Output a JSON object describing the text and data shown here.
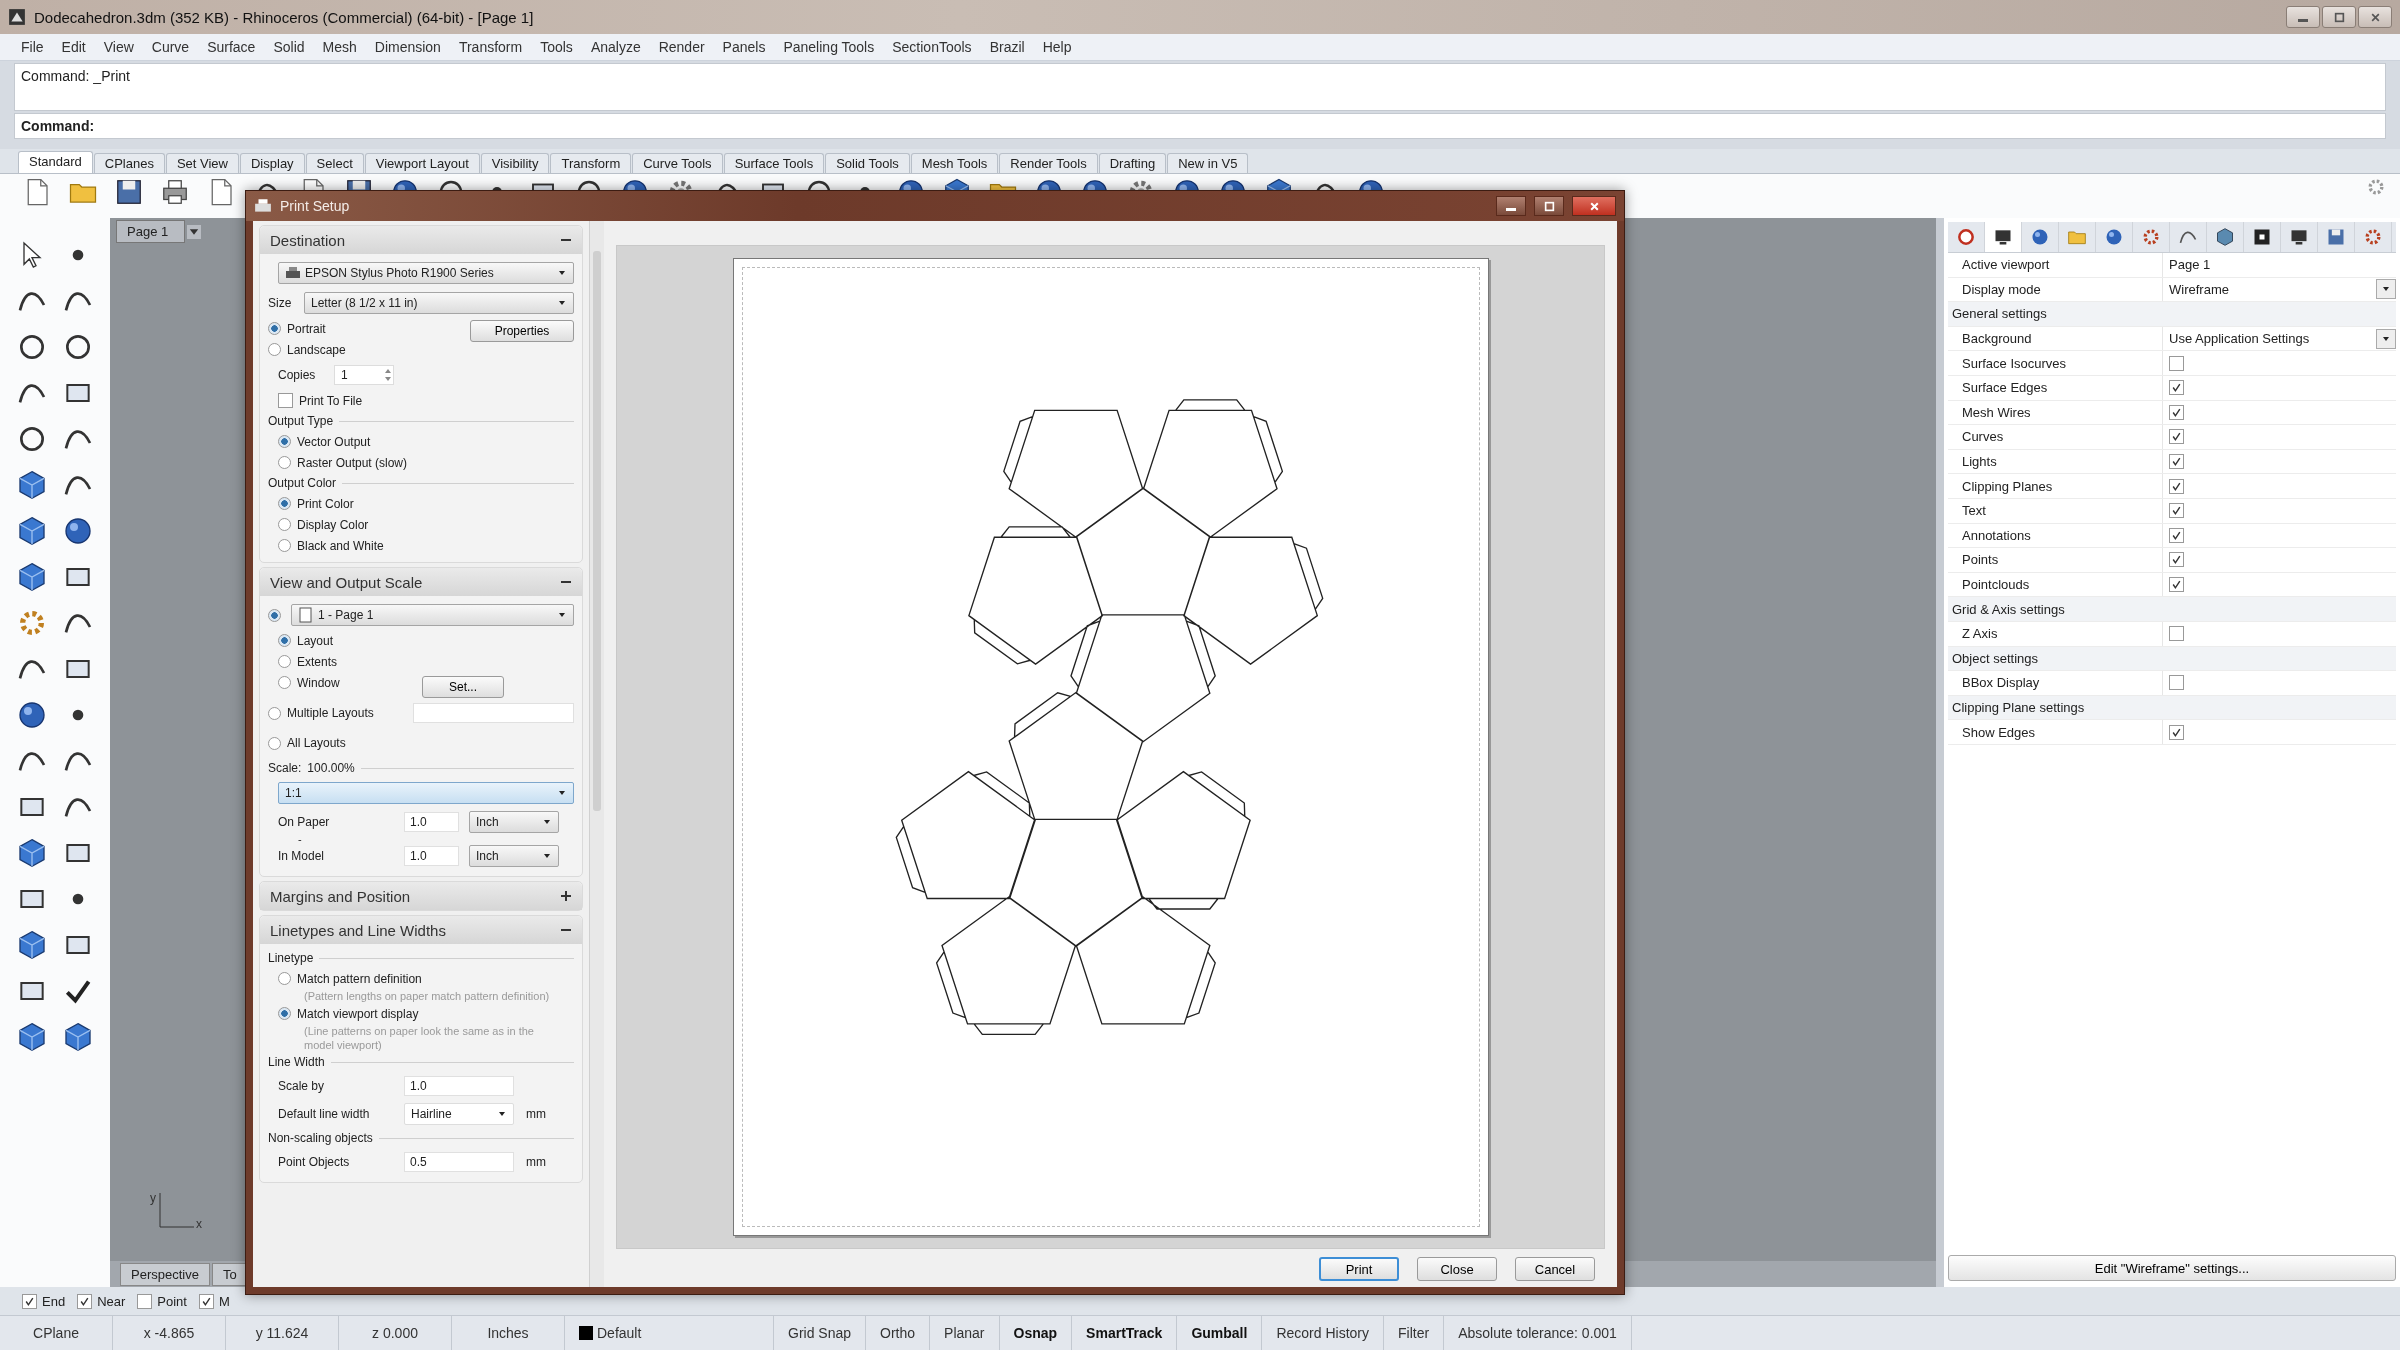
{
  "window": {
    "title": "Dodecahedron.3dm (352 KB) - Rhinoceros (Commercial) (64-bit) - [Page 1]"
  },
  "menu": [
    "File",
    "Edit",
    "View",
    "Curve",
    "Surface",
    "Solid",
    "Mesh",
    "Dimension",
    "Transform",
    "Tools",
    "Analyze",
    "Render",
    "Panels",
    "Paneling Tools",
    "SectionTools",
    "Brazil",
    "Help"
  ],
  "command": {
    "history": "Command: _Print",
    "prompt": "Command:"
  },
  "toolbar_tabs": [
    {
      "label": "Standard",
      "selected": true
    },
    {
      "label": "CPlanes",
      "selected": false
    },
    {
      "label": "Set View",
      "selected": false
    },
    {
      "label": "Display",
      "selected": false
    },
    {
      "label": "Select",
      "selected": false
    },
    {
      "label": "Viewport Layout",
      "selected": false
    },
    {
      "label": "Visibility",
      "selected": false
    },
    {
      "label": "Transform",
      "selected": false
    },
    {
      "label": "Curve Tools",
      "selected": false
    },
    {
      "label": "Surface Tools",
      "selected": false
    },
    {
      "label": "Solid Tools",
      "selected": false
    },
    {
      "label": "Mesh Tools",
      "selected": false
    },
    {
      "label": "Render Tools",
      "selected": false
    },
    {
      "label": "Drafting",
      "selected": false
    },
    {
      "label": "New in V5",
      "selected": false
    }
  ],
  "viewport": {
    "page_tab": "Page 1",
    "axis_x": "x",
    "axis_y": "y",
    "tabs": [
      {
        "label": "Perspective",
        "selected": false
      },
      {
        "label": "To",
        "selected": false
      }
    ]
  },
  "osnaps": [
    {
      "label": "End",
      "checked": true
    },
    {
      "label": "Near",
      "checked": true
    },
    {
      "label": "Point",
      "checked": false
    },
    {
      "label": "M",
      "checked": true
    }
  ],
  "print_setup": {
    "title": "Print Setup",
    "destination": {
      "title": "Destination",
      "expanded": true,
      "printer": "EPSON Stylus Photo R1900 Series",
      "size_label": "Size",
      "size": "Letter (8 1/2 x 11 in)",
      "orientations": [
        {
          "label": "Portrait",
          "selected": true
        },
        {
          "label": "Landscape",
          "selected": false
        }
      ],
      "properties_button": "Properties",
      "copies_label": "Copies",
      "copies": "1",
      "print_to_file": {
        "label": "Print To File",
        "checked": false
      },
      "output_type": {
        "title": "Output Type",
        "options": [
          {
            "label": "Vector Output",
            "selected": true
          },
          {
            "label": "Raster Output (slow)",
            "selected": false
          }
        ]
      },
      "output_color": {
        "title": "Output Color",
        "options": [
          {
            "label": "Print Color",
            "selected": true
          },
          {
            "label": "Display Color",
            "selected": false
          },
          {
            "label": "Black and White",
            "selected": false
          }
        ]
      }
    },
    "view_scale": {
      "title": "View and Output Scale",
      "expanded": true,
      "view_selected": true,
      "view": "1 - Page 1",
      "modes": [
        {
          "label": "Layout",
          "selected": true
        },
        {
          "label": "Extents",
          "selected": false
        },
        {
          "label": "Window",
          "selected": false
        }
      ],
      "set_button": "Set...",
      "multiple_layouts": {
        "label": "Multiple Layouts",
        "selected": false
      },
      "all_layouts": {
        "label": "All Layouts",
        "selected": false
      },
      "scale_label": "Scale:",
      "scale_value": "100.00%",
      "scale": "1:1",
      "on_paper_label": "On Paper",
      "on_paper": "1.0",
      "on_paper_unit": "Inch",
      "ratio_mark": "-",
      "in_model_label": "In Model",
      "in_model": "1.0",
      "in_model_unit": "Inch"
    },
    "margins": {
      "title": "Margins and Position",
      "expanded": false
    },
    "linetypes": {
      "title": "Linetypes and Line Widths",
      "expanded": true,
      "linetype_title": "Linetype",
      "options": [
        {
          "label": "Match pattern definition",
          "note": "(Pattern lengths on paper match pattern definition)",
          "selected": false
        },
        {
          "label": "Match viewport display",
          "note": "(Line patterns on paper look the same as in the model viewport)",
          "selected": true
        }
      ],
      "line_width_title": "Line Width",
      "scale_by_label": "Scale by",
      "scale_by": "1.0",
      "default_width_label": "Default line width",
      "default_width": "Hairline",
      "default_width_unit": "mm",
      "non_scaling_title": "Non-scaling objects",
      "point_objects_label": "Point Objects",
      "point_objects": "0.5",
      "point_objects_unit": "mm"
    },
    "buttons": [
      {
        "label": "Print",
        "default": true
      },
      {
        "label": "Close",
        "default": false
      },
      {
        "label": "Cancel",
        "default": false
      }
    ]
  },
  "properties": {
    "tabs": [
      {
        "selected": false
      },
      {
        "selected": true
      },
      {
        "selected": false
      },
      {
        "selected": false
      },
      {
        "selected": false
      },
      {
        "selected": false
      },
      {
        "selected": false
      },
      {
        "selected": false
      },
      {
        "selected": false
      },
      {
        "selected": false
      },
      {
        "selected": false
      },
      {
        "selected": false
      }
    ],
    "rows": [
      {
        "kind": "value",
        "label": "Active viewport",
        "value": "Page 1"
      },
      {
        "kind": "dropdown",
        "label": "Display mode",
        "value": "Wireframe"
      },
      {
        "kind": "section",
        "label": "General settings"
      },
      {
        "kind": "dropdown",
        "label": "Background",
        "value": "Use Application Settings"
      },
      {
        "kind": "check",
        "label": "Surface Isocurves",
        "checked": false
      },
      {
        "kind": "check",
        "label": "Surface Edges",
        "checked": true
      },
      {
        "kind": "check",
        "label": "Mesh Wires",
        "checked": true
      },
      {
        "kind": "check",
        "label": "Curves",
        "checked": true
      },
      {
        "kind": "check",
        "label": "Lights",
        "checked": true
      },
      {
        "kind": "check",
        "label": "Clipping Planes",
        "checked": true
      },
      {
        "kind": "check",
        "label": "Text",
        "checked": true
      },
      {
        "kind": "check",
        "label": "Annotations",
        "checked": true
      },
      {
        "kind": "check",
        "label": "Points",
        "checked": true
      },
      {
        "kind": "check",
        "label": "Pointclouds",
        "checked": true
      },
      {
        "kind": "section",
        "label": "Grid & Axis settings"
      },
      {
        "kind": "check",
        "label": "Z Axis",
        "checked": false
      },
      {
        "kind": "section",
        "label": "Object settings"
      },
      {
        "kind": "check",
        "label": "BBox Display",
        "checked": false
      },
      {
        "kind": "section",
        "label": "Clipping Plane settings"
      },
      {
        "kind": "check",
        "label": "Show Edges",
        "checked": true
      }
    ],
    "edit_button": "Edit \"Wireframe\" settings..."
  },
  "status_bar": [
    {
      "kind": "text",
      "text": "CPlane"
    },
    {
      "kind": "text",
      "text": "x -4.865"
    },
    {
      "kind": "text",
      "text": "y 11.624"
    },
    {
      "kind": "text",
      "text": "z 0.000"
    },
    {
      "kind": "text",
      "text": "Inches"
    },
    {
      "kind": "layer",
      "text": "Default",
      "color": "#000000"
    },
    {
      "kind": "toggle",
      "text": "Grid Snap",
      "on": false
    },
    {
      "kind": "toggle",
      "text": "Ortho",
      "on": false
    },
    {
      "kind": "toggle",
      "text": "Planar",
      "on": false
    },
    {
      "kind": "toggle",
      "text": "Osnap",
      "on": true
    },
    {
      "kind": "toggle",
      "text": "SmartTrack",
      "on": true
    },
    {
      "kind": "toggle",
      "text": "Gumball",
      "on": true
    },
    {
      "kind": "toggle",
      "text": "Record History",
      "on": false
    },
    {
      "kind": "toggle",
      "text": "Filter",
      "on": false
    },
    {
      "kind": "text",
      "text": "Absolute tolerance: 0.001"
    }
  ]
}
